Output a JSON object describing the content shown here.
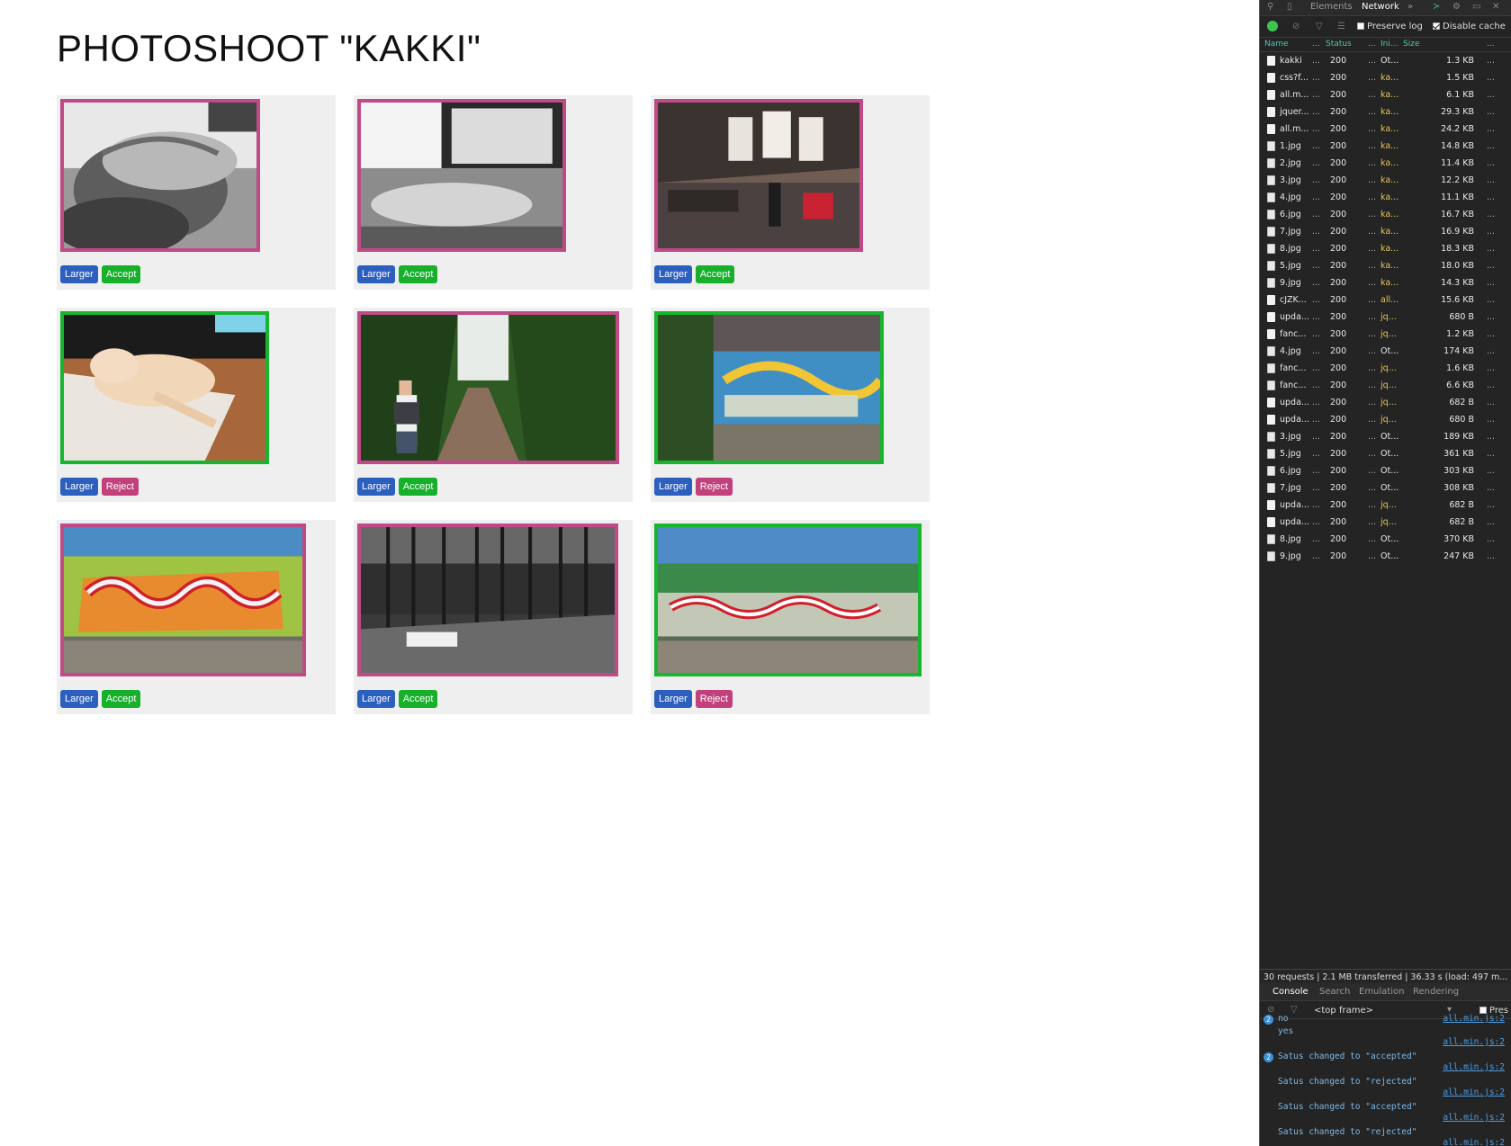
{
  "page": {
    "title": "PHOTOSHOOT \"KAKKI\"",
    "cards": [
      {
        "larger_label": "Larger",
        "action_label": "Accept",
        "status": "pending",
        "scene": "cat-sofa"
      },
      {
        "larger_label": "Larger",
        "action_label": "Accept",
        "status": "pending",
        "scene": "cat-desk"
      },
      {
        "larger_label": "Larger",
        "action_label": "Accept",
        "status": "pending",
        "scene": "office"
      },
      {
        "larger_label": "Larger",
        "action_label": "Reject",
        "status": "accepted",
        "scene": "cat-paper"
      },
      {
        "larger_label": "Larger",
        "action_label": "Accept",
        "status": "pending",
        "scene": "forest-path"
      },
      {
        "larger_label": "Larger",
        "action_label": "Reject",
        "status": "accepted",
        "scene": "graffiti-tunnel"
      },
      {
        "larger_label": "Larger",
        "action_label": "Accept",
        "status": "pending",
        "scene": "graffiti-wall"
      },
      {
        "larger_label": "Larger",
        "action_label": "Accept",
        "status": "pending",
        "scene": "forest-bw"
      },
      {
        "larger_label": "Larger",
        "action_label": "Reject",
        "status": "accepted",
        "scene": "graffiti-wide"
      }
    ]
  },
  "colors": {
    "pending_border": "#c04a86",
    "accepted_border": "#18b52e",
    "larger_btn": "#2d60be",
    "accept_btn": "#16b02b",
    "reject_btn": "#c2417d"
  },
  "devtools": {
    "tabs": {
      "elements": "Elements",
      "network": "Network",
      "more": "»"
    },
    "toolbar": {
      "preserve_log": "Preserve log",
      "disable_cache": "Disable cache"
    },
    "columns": {
      "name": "Name",
      "dots1": "...",
      "status": "Status",
      "dots2": "...",
      "initiator": "Ini...",
      "size": "Size",
      "dots3": "..."
    },
    "rows": [
      {
        "name": "kakki",
        "status": "200",
        "initiator": "Ot...",
        "size": "1.3 KB",
        "type": "doc"
      },
      {
        "name": "css?f...",
        "status": "200",
        "initiator": "ka...",
        "size": "1.5 KB",
        "type": "doc"
      },
      {
        "name": "all.m...",
        "status": "200",
        "initiator": "ka...",
        "size": "6.1 KB",
        "type": "doc"
      },
      {
        "name": "jquer...",
        "status": "200",
        "initiator": "ka...",
        "size": "29.3 KB",
        "type": "doc"
      },
      {
        "name": "all.m...",
        "status": "200",
        "initiator": "ka...",
        "size": "24.2 KB",
        "type": "doc"
      },
      {
        "name": "1.jpg",
        "status": "200",
        "initiator": "ka...",
        "size": "14.8 KB",
        "type": "img"
      },
      {
        "name": "2.jpg",
        "status": "200",
        "initiator": "ka...",
        "size": "11.4 KB",
        "type": "img"
      },
      {
        "name": "3.jpg",
        "status": "200",
        "initiator": "ka...",
        "size": "12.2 KB",
        "type": "img"
      },
      {
        "name": "4.jpg",
        "status": "200",
        "initiator": "ka...",
        "size": "11.1 KB",
        "type": "img"
      },
      {
        "name": "6.jpg",
        "status": "200",
        "initiator": "ka...",
        "size": "16.7 KB",
        "type": "img"
      },
      {
        "name": "7.jpg",
        "status": "200",
        "initiator": "ka...",
        "size": "16.9 KB",
        "type": "img"
      },
      {
        "name": "8.jpg",
        "status": "200",
        "initiator": "ka...",
        "size": "18.3 KB",
        "type": "img"
      },
      {
        "name": "5.jpg",
        "status": "200",
        "initiator": "ka...",
        "size": "18.0 KB",
        "type": "img"
      },
      {
        "name": "9.jpg",
        "status": "200",
        "initiator": "ka...",
        "size": "14.3 KB",
        "type": "img"
      },
      {
        "name": "cJZK...",
        "status": "200",
        "initiator": "all...",
        "size": "15.6 KB",
        "type": "doc"
      },
      {
        "name": "upda...",
        "status": "200",
        "initiator": "jq...",
        "size": "680 B",
        "type": "doc"
      },
      {
        "name": "fanc...",
        "status": "200",
        "initiator": "jq...",
        "size": "1.2 KB",
        "type": "doc"
      },
      {
        "name": "4.jpg",
        "status": "200",
        "initiator": "Ot...",
        "size": "174 KB",
        "type": "img"
      },
      {
        "name": "fanc...",
        "status": "200",
        "initiator": "jq...",
        "size": "1.6 KB",
        "type": "img"
      },
      {
        "name": "fanc...",
        "status": "200",
        "initiator": "jq...",
        "size": "6.6 KB",
        "type": "img"
      },
      {
        "name": "upda...",
        "status": "200",
        "initiator": "jq...",
        "size": "682 B",
        "type": "doc"
      },
      {
        "name": "upda...",
        "status": "200",
        "initiator": "jq...",
        "size": "680 B",
        "type": "doc"
      },
      {
        "name": "3.jpg",
        "status": "200",
        "initiator": "Ot...",
        "size": "189 KB",
        "type": "img"
      },
      {
        "name": "5.jpg",
        "status": "200",
        "initiator": "Ot...",
        "size": "361 KB",
        "type": "img"
      },
      {
        "name": "6.jpg",
        "status": "200",
        "initiator": "Ot...",
        "size": "303 KB",
        "type": "img"
      },
      {
        "name": "7.jpg",
        "status": "200",
        "initiator": "Ot...",
        "size": "308 KB",
        "type": "img"
      },
      {
        "name": "upda...",
        "status": "200",
        "initiator": "jq...",
        "size": "682 B",
        "type": "doc"
      },
      {
        "name": "upda...",
        "status": "200",
        "initiator": "jq...",
        "size": "682 B",
        "type": "doc"
      },
      {
        "name": "8.jpg",
        "status": "200",
        "initiator": "Ot...",
        "size": "370 KB",
        "type": "img"
      },
      {
        "name": "9.jpg",
        "status": "200",
        "initiator": "Ot...",
        "size": "247 KB",
        "type": "img"
      }
    ],
    "summary": "30 requests  |  2.1 MB transferred  |  36.33 s (load: 497 m...",
    "console_tabs": {
      "console": "Console",
      "search": "Search",
      "emulation": "Emulation",
      "rendering": "Rendering"
    },
    "frame_select": "<top frame>",
    "preserve_short": "Pres",
    "console_lines": [
      {
        "badge": "2",
        "text": "no",
        "src": "all.min.js:2"
      },
      {
        "badge": "",
        "text": "yes",
        "src": "all.min.js:2"
      },
      {
        "badge": "2",
        "text": "Satus changed to \"accepted\"",
        "src": "all.min.js:2"
      },
      {
        "badge": "",
        "text": "Satus changed to \"rejected\"",
        "src": "all.min.js:2"
      },
      {
        "badge": "",
        "text": "Satus changed to \"accepted\"",
        "src": "all.min.js:2"
      },
      {
        "badge": "",
        "text": "Satus changed to \"rejected\"",
        "src": "all.min.js:2"
      }
    ]
  }
}
